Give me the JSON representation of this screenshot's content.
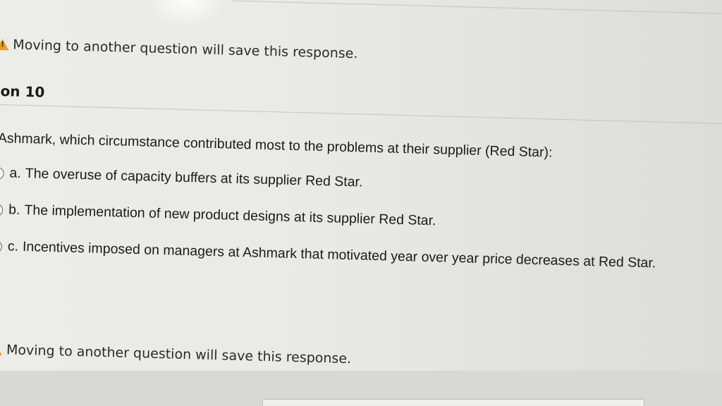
{
  "warning_top": {
    "text": "Moving to another question will save this response.",
    "icon": "warning-icon"
  },
  "question": {
    "title": "on 10",
    "text": "Ashmark, which circumstance contributed most to the problems at their supplier (Red Star):"
  },
  "options": [
    {
      "letter": "a.",
      "text": "The overuse of capacity buffers at its supplier Red Star."
    },
    {
      "letter": "b.",
      "text": "The implementation of new product designs at its supplier Red Star."
    },
    {
      "letter": "c.",
      "text": "Incentives imposed on managers at Ashmark that motivated year over year price decreases at Red Star."
    }
  ],
  "warning_bottom": {
    "text": "Moving to another question will save this response.",
    "icon": "warning-icon"
  },
  "colors": {
    "warning": "#e0a116",
    "background": "#e9e9e6",
    "text": "#1b1b1b"
  }
}
